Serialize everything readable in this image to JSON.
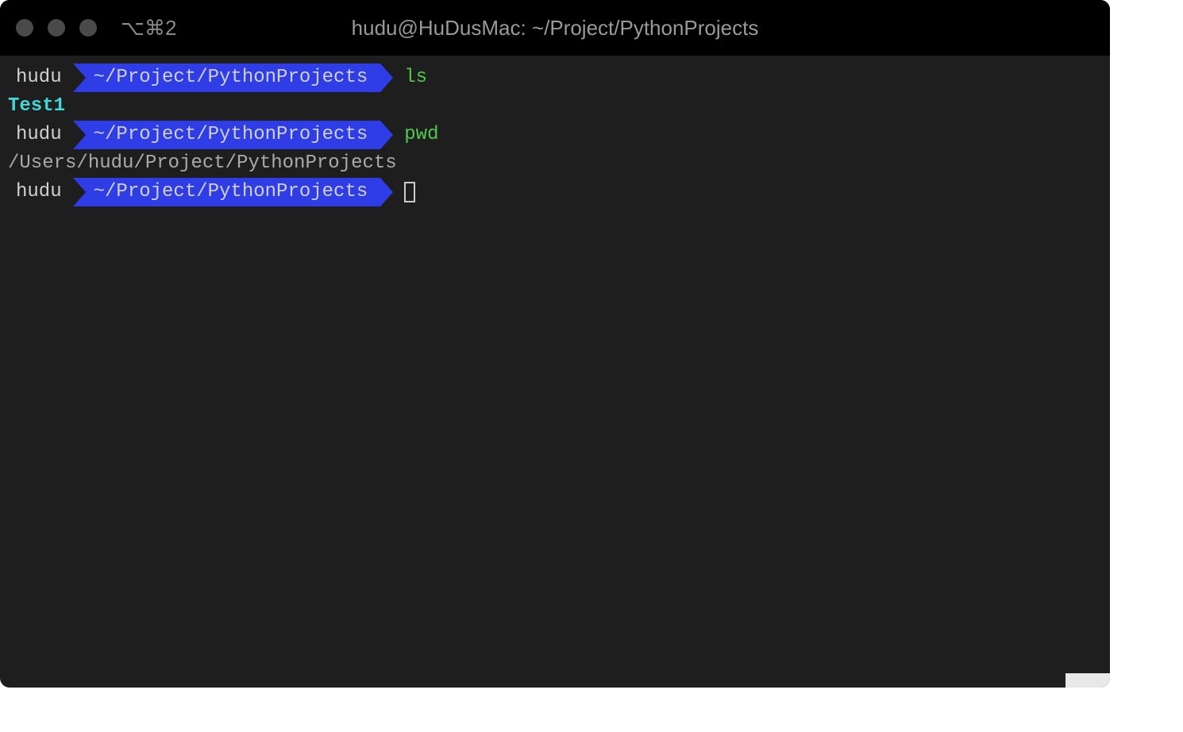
{
  "window": {
    "title": "hudu@HuDusMac: ~/Project/PythonProjects",
    "tab_label": "⌥⌘2"
  },
  "prompt": {
    "user": "hudu",
    "path": "~/Project/PythonProjects"
  },
  "lines": [
    {
      "type": "prompt",
      "command": "ls"
    },
    {
      "type": "output",
      "style": "cyan",
      "text": "Test1"
    },
    {
      "type": "prompt",
      "command": "pwd"
    },
    {
      "type": "output",
      "style": "grey",
      "text": "/Users/hudu/Project/PythonProjects"
    },
    {
      "type": "prompt",
      "command": "",
      "cursor": true
    }
  ]
}
